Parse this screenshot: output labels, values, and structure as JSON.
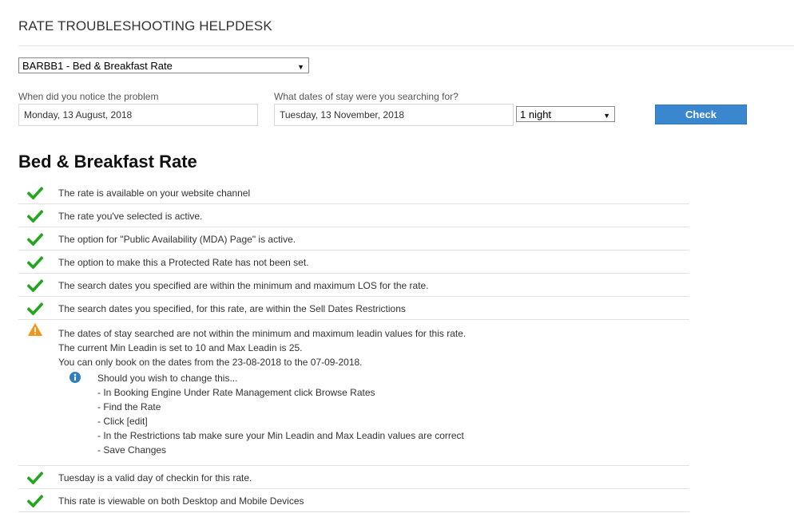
{
  "header": {
    "title": "RATE TROUBLESHOOTING HELPDESK"
  },
  "rate_select": {
    "value": "BARBB1 - Bed & Breakfast Rate"
  },
  "notice": {
    "label": "When did you notice the problem",
    "value": "Monday, 13 August, 2018"
  },
  "stay": {
    "label": "What dates of stay were you searching for?",
    "value": "Tuesday, 13 November, 2018"
  },
  "nights_select": {
    "value": "1 night"
  },
  "check_button": {
    "label": "Check"
  },
  "section": {
    "heading": "Bed & Breakfast Rate"
  },
  "results": [
    {
      "status": "ok",
      "icon": "check-icon",
      "text": "The rate is available on your website channel"
    },
    {
      "status": "ok",
      "icon": "check-icon",
      "text": "The rate you've selected is active."
    },
    {
      "status": "ok",
      "icon": "check-icon",
      "text": "The option for \"Public Availability (MDA) Page\" is active."
    },
    {
      "status": "ok",
      "icon": "check-icon",
      "text": "The option to make this a Protected Rate has not been set."
    },
    {
      "status": "ok",
      "icon": "check-icon",
      "text": "The search dates you specified are within the minimum and maximum LOS for the rate."
    },
    {
      "status": "ok",
      "icon": "check-icon",
      "text": "The search dates you specified, for this rate, are within the Sell Dates Restrictions"
    }
  ],
  "warning": {
    "status": "warning",
    "icon": "warning-icon",
    "lines": [
      "The dates of stay searched are not within the minimum and maximum leadin values for this rate.",
      "The current Min Leadin is set to 10 and Max Leadin is 25.",
      "You can only book on the dates from the 23-08-2018 to the 07-09-2018."
    ],
    "info": {
      "icon": "info-icon",
      "lines": [
        "Should you wish to change this...",
        "- In Booking Engine Under Rate Management click Browse Rates",
        "- Find the Rate",
        "- Click [edit]",
        "- In the Restrictions tab make sure your Min Leadin and Max Leadin values are correct",
        "- Save Changes"
      ]
    }
  },
  "results_after": [
    {
      "status": "ok",
      "icon": "check-icon",
      "text": "Tuesday is a valid day of checkin for this rate."
    },
    {
      "status": "ok",
      "icon": "check-icon",
      "text": "This rate is viewable on both Desktop and Mobile Devices"
    }
  ],
  "colors": {
    "ok": "#22a61d",
    "warning": "#f0961c",
    "info": "#2d7fc1",
    "button": "#3a87cf"
  }
}
